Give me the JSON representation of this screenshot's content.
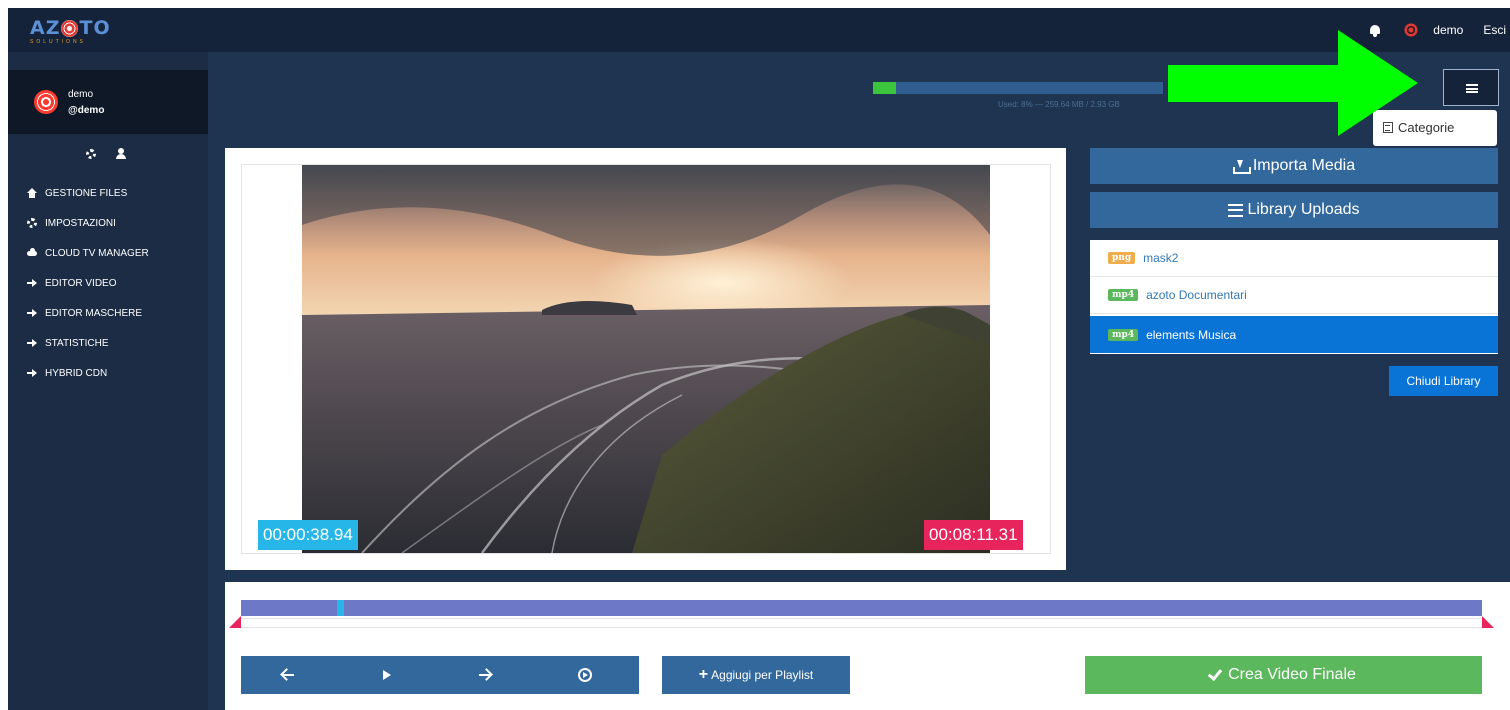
{
  "app": {
    "logo_text": "AZOTO",
    "logo_sub": "SOLUTIONS"
  },
  "topbar": {
    "user_name": "demo",
    "logout_label": "Esci"
  },
  "profile": {
    "name": "demo",
    "handle": "@demo"
  },
  "sidebar": {
    "items": [
      {
        "label": "GESTIONE FILES",
        "icon": "home-icon"
      },
      {
        "label": "IMPOSTAZIONI",
        "icon": "gear-icon"
      },
      {
        "label": "CLOUD TV MANAGER",
        "icon": "cloud-icon"
      },
      {
        "label": "EDITOR VIDEO",
        "icon": "arrow-right-icon"
      },
      {
        "label": "EDITOR MASCHERE",
        "icon": "arrow-right-icon"
      },
      {
        "label": "STATISTICHE",
        "icon": "arrow-right-icon"
      },
      {
        "label": "HYBRID CDN",
        "icon": "arrow-right-icon"
      }
    ]
  },
  "storage": {
    "used_fraction": 0.08,
    "label": "Used: 8% — 259.64 MB / 2.93 GB"
  },
  "menu": {
    "dropdown_item": "Categorie"
  },
  "video": {
    "current_time": "00:00:38.94",
    "total_time": "00:08:11.31"
  },
  "panel": {
    "import_label": "Importa Media",
    "library_label": "Library Uploads",
    "close_library_label": "Chiudi Library"
  },
  "library": {
    "items": [
      {
        "badge": "png",
        "badge_color": "#f0ad4e",
        "name": "mask2",
        "active": false
      },
      {
        "badge": "mp4",
        "badge_color": "#5cb85c",
        "name": "azoto Documentari",
        "active": false
      },
      {
        "badge": "mp4",
        "badge_color": "#5cb85c",
        "name": "elements Musica",
        "active": true
      }
    ]
  },
  "timeline": {
    "cursor_fraction": 0.077
  },
  "actions": {
    "playlist_label": "Aggiugi per Playlist",
    "final_label": "Crea Video Finale"
  },
  "colors": {
    "sidebar": "#1b2c44",
    "main": "#1e3450",
    "topbar": "#15233a",
    "button": "#33689c",
    "active": "#0a74d6",
    "success": "#5cb85c",
    "time_current": "#26b6e8",
    "time_total": "#e8245c",
    "overlay_arrow": "#00ff00"
  }
}
